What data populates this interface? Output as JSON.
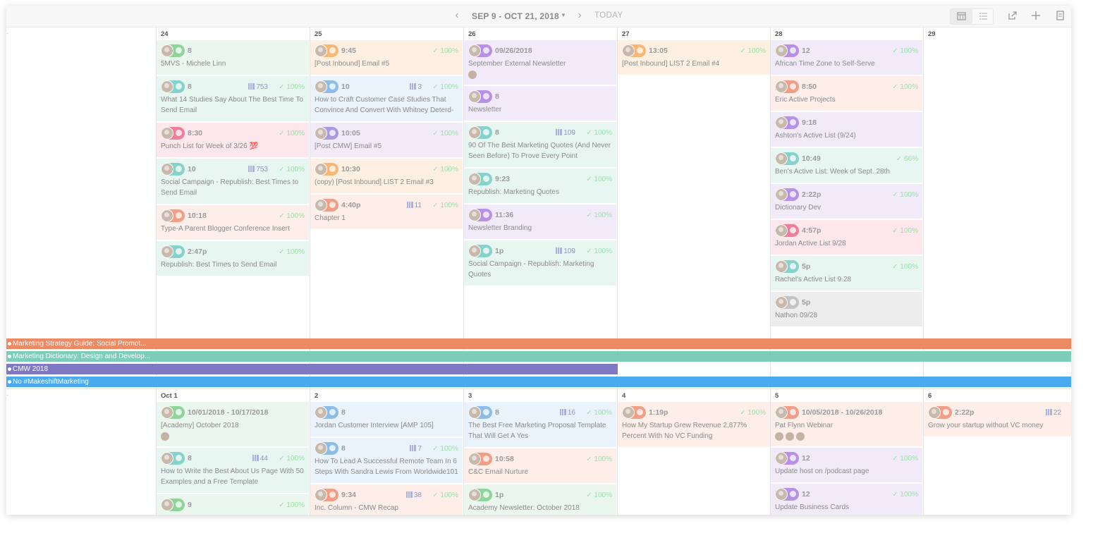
{
  "toolbar": {
    "date_range": "SEP 9 - OCT 21, 2018",
    "today_label": "TODAY",
    "icons": [
      "chevron-left-icon",
      "chevron-right-icon",
      "caret-down-icon",
      "calendar-view-icon",
      "list-view-icon",
      "share-icon",
      "plus-icon",
      "document-icon"
    ]
  },
  "colors": {
    "orange": "#fdf0e2",
    "blue": "#eaf2fb",
    "purple": "#f1ebf9",
    "green": "#eaf6ee",
    "teal": "#e8f6f2",
    "pink": "#fbe7ec",
    "gray": "#ededed",
    "salmon": "#fdeeea"
  },
  "week1": {
    "days": [
      "24",
      "25",
      "26",
      "27",
      "28",
      "29"
    ],
    "cols": [
      [
        {
          "time": "8",
          "title": "5MVS - Michele Linn",
          "color": "green",
          "pill": "#8fd49a"
        },
        {
          "time": "8",
          "stat": "753",
          "check": "100%",
          "title": "What 14 Studies Say About The Best Time To Send Email",
          "color": "teal",
          "pill": "#88d2cc"
        },
        {
          "time": "8:30",
          "check": "100%",
          "title": "Punch List for Week of 3/26 💯",
          "color": "pink",
          "pill": "#ee7f9c"
        },
        {
          "time": "10",
          "stat": "753",
          "check": "100%",
          "title": "Social Campaign - Republish: Best Times to Send Email",
          "color": "teal",
          "pill": "#88d2cc"
        },
        {
          "time": "10:18",
          "check": "100%",
          "title": "Type-A Parent Blogger Conference Insert",
          "color": "salmon",
          "pill": "#f29d86"
        },
        {
          "time": "2:47p",
          "check": "100%",
          "title": "Republish: Best Times to Send Email",
          "color": "teal",
          "pill": "#88d2cc"
        }
      ],
      [
        {
          "time": "9:45",
          "check": "100%",
          "title": "[Post Inbound] Email #5",
          "color": "orange",
          "pill": "#f7b876"
        },
        {
          "time": "10",
          "stat": "3",
          "check": "100%",
          "title": "How to Craft Customer Case Studies That Convince And Convert With Whitney Deterd-",
          "color": "blue",
          "pill": "#8bbde8"
        },
        {
          "time": "10:05",
          "check": "100%",
          "title": "[Post CMW] Email #5",
          "color": "purple",
          "pill": "#a89ae0"
        },
        {
          "time": "10:30",
          "check": "100%",
          "title": "(copy) [Post Inbound] LIST 2 Email #3",
          "color": "orange",
          "pill": "#f7b876"
        },
        {
          "time": "4:40p",
          "stat": "11",
          "check": "100%",
          "title": "Chapter 1",
          "color": "salmon",
          "pill": "#f29d86"
        }
      ],
      [
        {
          "time": "09/26/2018",
          "title": "September External Newsletter",
          "color": "purple",
          "pill": "#b691e6",
          "attendees": 1
        },
        {
          "time": "8",
          "title": "Newsletter",
          "color": "purple",
          "pill": "#b691e6"
        },
        {
          "time": "8",
          "stat": "109",
          "check": "100%",
          "title": "90 Of The Best Marketing Quotes (And Never Seen Before) To Prove Every Point",
          "color": "teal",
          "pill": "#88d2cc"
        },
        {
          "time": "9:23",
          "check": "100%",
          "title": "Republish: Marketing Quotes",
          "color": "teal",
          "pill": "#88d2cc"
        },
        {
          "time": "11:36",
          "check": "100%",
          "title": "Newsletter Branding",
          "color": "purple",
          "pill": "#b691e6"
        },
        {
          "time": "1p",
          "stat": "109",
          "check": "100%",
          "title": "Social Campaign - Republish: Marketing Quotes",
          "color": "teal",
          "pill": "#88d2cc"
        }
      ],
      [
        {
          "time": "13:05",
          "check": "100%",
          "title": "[Post Inbound] LIST 2 Email #4",
          "color": "orange",
          "pill": "#f7b876"
        }
      ],
      [
        {
          "time": "12",
          "check": "100%",
          "title": "African Time Zone to Self-Serve",
          "color": "purple",
          "pill": "#b691e6"
        },
        {
          "time": "8:50",
          "check": "100%",
          "title": "Eric Active Projects",
          "color": "salmon",
          "pill": "#f29d86"
        },
        {
          "time": "9:18",
          "title": "Ashton's Active List (9/24)",
          "color": "purple",
          "pill": "#b691e6"
        },
        {
          "time": "10:49",
          "check": "66%",
          "title": "Ben's Active List: Week of Sept. 28th",
          "color": "teal",
          "pill": "#88d2cc"
        },
        {
          "time": "2:22p",
          "check": "100%",
          "title": "Dictionary Dev",
          "color": "purple",
          "pill": "#b691e6"
        },
        {
          "time": "4:57p",
          "check": "100%",
          "title": "Jordan Active List 9/28",
          "color": "pink",
          "pill": "#ee7f9c"
        },
        {
          "time": "5p",
          "check": "100%",
          "title": "Rachel's Active List 9.28",
          "color": "teal",
          "pill": "#88d2cc"
        },
        {
          "time": "5p",
          "title": "Nathon 09/28",
          "color": "gray",
          "pill": "#c3c3c3"
        }
      ],
      []
    ]
  },
  "projects": [
    {
      "label": "Marketing Strategy Guide: Social Promot...",
      "color": "#ec8a64"
    },
    {
      "label": "Marketing Dictionary: Design and Develop...",
      "color": "#7dcdb9"
    },
    {
      "label": "CMW 2018",
      "color": "#7f78c3"
    },
    {
      "label": "No #MakeshiftMarketing",
      "color": "#4aaaf0"
    }
  ],
  "week2": {
    "days": [
      "Oct 1",
      "2",
      "3",
      "4",
      "5",
      "6"
    ],
    "cols": [
      [
        {
          "time": "10/01/2018 - 10/17/2018",
          "title": "[Academy] October 2018",
          "color": "green",
          "pill": "#8fd49a",
          "attendees": 1
        },
        {
          "time": "8",
          "stat": "44",
          "check": "100%",
          "title": "How to Write the Best About Us Page With 50 Examples and a Free Template",
          "color": "teal",
          "pill": "#88d2cc"
        },
        {
          "time": "9",
          "check": "100%",
          "title": "",
          "color": "green",
          "pill": "#8fd49a"
        }
      ],
      [
        {
          "time": "8",
          "title": "Jordan Customer Interview [AMP 105]",
          "color": "blue",
          "pill": "#8bbde8"
        },
        {
          "time": "8",
          "stat": "7",
          "check": "100%",
          "title": "How To Lead A Successful Remote Team In 6 Steps With Sandra Lewis From Worldwide101",
          "color": "blue",
          "pill": "#8bbde8"
        },
        {
          "time": "9:34",
          "stat": "38",
          "check": "100%",
          "title": "Inc. Column - CMW Recap",
          "color": "salmon",
          "pill": "#f29d86"
        }
      ],
      [
        {
          "time": "8",
          "stat": "16",
          "check": "100%",
          "title": "The Best Free Marketing Proposal Template That Will Get A Yes",
          "color": "blue",
          "pill": "#8bbde8"
        },
        {
          "time": "10:58",
          "check": "100%",
          "title": "C&C Email Nurture",
          "color": "salmon",
          "pill": "#f29d86"
        },
        {
          "time": "1p",
          "check": "100%",
          "title": "Academy Newsletter: October 2018",
          "color": "green",
          "pill": "#8fd49a"
        }
      ],
      [
        {
          "time": "1:19p",
          "check": "100%",
          "title": "How My Startup Grew Revenue 2,877% Percent With No VC Funding",
          "color": "salmon",
          "pill": "#f29d86"
        }
      ],
      [
        {
          "time": "10/05/2018 - 10/26/2018",
          "title": "Pat Flynn Webinar",
          "color": "salmon",
          "pill": "#f29d86",
          "attendees": 3
        },
        {
          "time": "12",
          "check": "100%",
          "title": "Update host on /podcast page",
          "color": "purple",
          "pill": "#b691e6"
        },
        {
          "time": "12",
          "check": "100%",
          "title": "Update Business Cards",
          "color": "purple",
          "pill": "#b691e6"
        }
      ],
      [
        {
          "time": "2:22p",
          "stat": "22",
          "title": "Grow your startup without VC money",
          "color": "salmon",
          "pill": "#f29d86"
        }
      ]
    ]
  }
}
